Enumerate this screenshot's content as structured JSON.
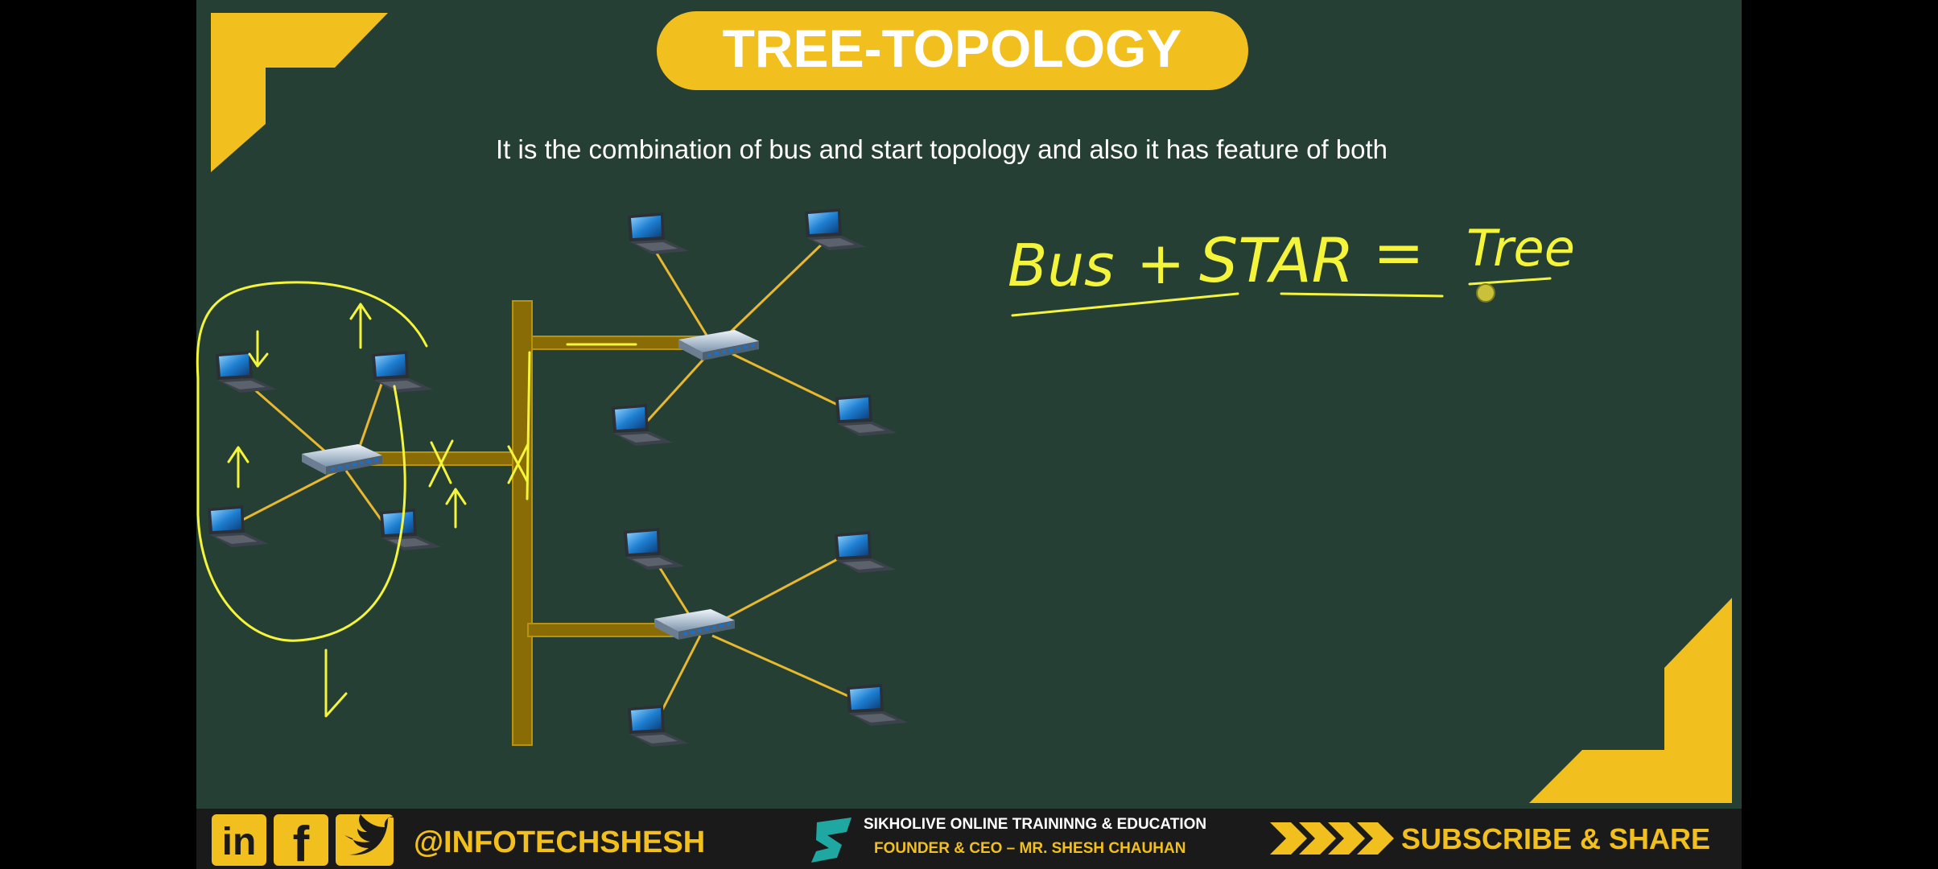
{
  "slide": {
    "title": "TREE-TOPOLOGY",
    "subtitle": "It is the combination of bus and start topology  and also it has feature of both",
    "handwritten": {
      "bus": "Bus",
      "plus": "+",
      "star": "STAR",
      "equals": "=",
      "tree": "Tree"
    }
  },
  "footer": {
    "social_handle": "@INFOTECHSHESH",
    "social_icons": [
      "linkedin-icon",
      "facebook-icon",
      "twitter-icon"
    ],
    "linkedin_glyph": "in",
    "facebook_glyph": "f",
    "org_name": "SIKHOLIVE ONLINE TRAININNG & EDUCATION",
    "founder": "FOUNDER & CEO – MR. SHESH CHAUHAN",
    "cta": "SUBSCRIBE & SHARE"
  },
  "colors": {
    "board": "#263f34",
    "accent": "#f2c01e",
    "ink": "#f4f53a",
    "cable": "#8a6c06",
    "link": "#e8b830",
    "footer_bg": "#1a1a1a"
  }
}
